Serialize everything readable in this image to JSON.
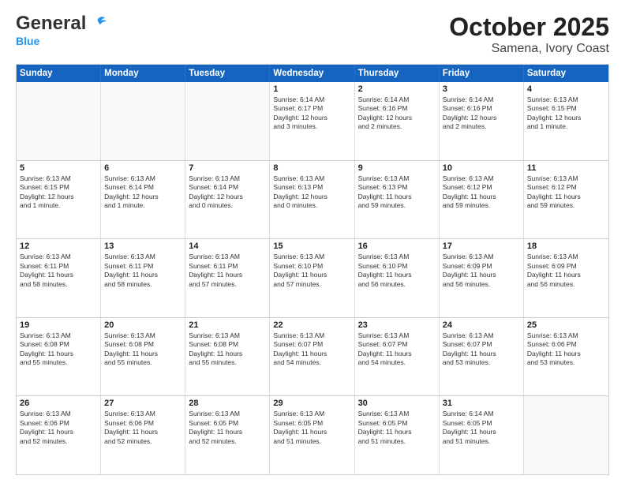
{
  "header": {
    "logo_general": "General",
    "logo_blue": "Blue",
    "main_title": "October 2025",
    "subtitle": "Samena, Ivory Coast"
  },
  "weekdays": [
    "Sunday",
    "Monday",
    "Tuesday",
    "Wednesday",
    "Thursday",
    "Friday",
    "Saturday"
  ],
  "weeks": [
    [
      {
        "day": "",
        "lines": []
      },
      {
        "day": "",
        "lines": []
      },
      {
        "day": "",
        "lines": []
      },
      {
        "day": "1",
        "lines": [
          "Sunrise: 6:14 AM",
          "Sunset: 6:17 PM",
          "Daylight: 12 hours",
          "and 3 minutes."
        ]
      },
      {
        "day": "2",
        "lines": [
          "Sunrise: 6:14 AM",
          "Sunset: 6:16 PM",
          "Daylight: 12 hours",
          "and 2 minutes."
        ]
      },
      {
        "day": "3",
        "lines": [
          "Sunrise: 6:14 AM",
          "Sunset: 6:16 PM",
          "Daylight: 12 hours",
          "and 2 minutes."
        ]
      },
      {
        "day": "4",
        "lines": [
          "Sunrise: 6:13 AM",
          "Sunset: 6:15 PM",
          "Daylight: 12 hours",
          "and 1 minute."
        ]
      }
    ],
    [
      {
        "day": "5",
        "lines": [
          "Sunrise: 6:13 AM",
          "Sunset: 6:15 PM",
          "Daylight: 12 hours",
          "and 1 minute."
        ]
      },
      {
        "day": "6",
        "lines": [
          "Sunrise: 6:13 AM",
          "Sunset: 6:14 PM",
          "Daylight: 12 hours",
          "and 1 minute."
        ]
      },
      {
        "day": "7",
        "lines": [
          "Sunrise: 6:13 AM",
          "Sunset: 6:14 PM",
          "Daylight: 12 hours",
          "and 0 minutes."
        ]
      },
      {
        "day": "8",
        "lines": [
          "Sunrise: 6:13 AM",
          "Sunset: 6:13 PM",
          "Daylight: 12 hours",
          "and 0 minutes."
        ]
      },
      {
        "day": "9",
        "lines": [
          "Sunrise: 6:13 AM",
          "Sunset: 6:13 PM",
          "Daylight: 11 hours",
          "and 59 minutes."
        ]
      },
      {
        "day": "10",
        "lines": [
          "Sunrise: 6:13 AM",
          "Sunset: 6:12 PM",
          "Daylight: 11 hours",
          "and 59 minutes."
        ]
      },
      {
        "day": "11",
        "lines": [
          "Sunrise: 6:13 AM",
          "Sunset: 6:12 PM",
          "Daylight: 11 hours",
          "and 59 minutes."
        ]
      }
    ],
    [
      {
        "day": "12",
        "lines": [
          "Sunrise: 6:13 AM",
          "Sunset: 6:11 PM",
          "Daylight: 11 hours",
          "and 58 minutes."
        ]
      },
      {
        "day": "13",
        "lines": [
          "Sunrise: 6:13 AM",
          "Sunset: 6:11 PM",
          "Daylight: 11 hours",
          "and 58 minutes."
        ]
      },
      {
        "day": "14",
        "lines": [
          "Sunrise: 6:13 AM",
          "Sunset: 6:11 PM",
          "Daylight: 11 hours",
          "and 57 minutes."
        ]
      },
      {
        "day": "15",
        "lines": [
          "Sunrise: 6:13 AM",
          "Sunset: 6:10 PM",
          "Daylight: 11 hours",
          "and 57 minutes."
        ]
      },
      {
        "day": "16",
        "lines": [
          "Sunrise: 6:13 AM",
          "Sunset: 6:10 PM",
          "Daylight: 11 hours",
          "and 56 minutes."
        ]
      },
      {
        "day": "17",
        "lines": [
          "Sunrise: 6:13 AM",
          "Sunset: 6:09 PM",
          "Daylight: 11 hours",
          "and 56 minutes."
        ]
      },
      {
        "day": "18",
        "lines": [
          "Sunrise: 6:13 AM",
          "Sunset: 6:09 PM",
          "Daylight: 11 hours",
          "and 56 minutes."
        ]
      }
    ],
    [
      {
        "day": "19",
        "lines": [
          "Sunrise: 6:13 AM",
          "Sunset: 6:08 PM",
          "Daylight: 11 hours",
          "and 55 minutes."
        ]
      },
      {
        "day": "20",
        "lines": [
          "Sunrise: 6:13 AM",
          "Sunset: 6:08 PM",
          "Daylight: 11 hours",
          "and 55 minutes."
        ]
      },
      {
        "day": "21",
        "lines": [
          "Sunrise: 6:13 AM",
          "Sunset: 6:08 PM",
          "Daylight: 11 hours",
          "and 55 minutes."
        ]
      },
      {
        "day": "22",
        "lines": [
          "Sunrise: 6:13 AM",
          "Sunset: 6:07 PM",
          "Daylight: 11 hours",
          "and 54 minutes."
        ]
      },
      {
        "day": "23",
        "lines": [
          "Sunrise: 6:13 AM",
          "Sunset: 6:07 PM",
          "Daylight: 11 hours",
          "and 54 minutes."
        ]
      },
      {
        "day": "24",
        "lines": [
          "Sunrise: 6:13 AM",
          "Sunset: 6:07 PM",
          "Daylight: 11 hours",
          "and 53 minutes."
        ]
      },
      {
        "day": "25",
        "lines": [
          "Sunrise: 6:13 AM",
          "Sunset: 6:06 PM",
          "Daylight: 11 hours",
          "and 53 minutes."
        ]
      }
    ],
    [
      {
        "day": "26",
        "lines": [
          "Sunrise: 6:13 AM",
          "Sunset: 6:06 PM",
          "Daylight: 11 hours",
          "and 52 minutes."
        ]
      },
      {
        "day": "27",
        "lines": [
          "Sunrise: 6:13 AM",
          "Sunset: 6:06 PM",
          "Daylight: 11 hours",
          "and 52 minutes."
        ]
      },
      {
        "day": "28",
        "lines": [
          "Sunrise: 6:13 AM",
          "Sunset: 6:05 PM",
          "Daylight: 11 hours",
          "and 52 minutes."
        ]
      },
      {
        "day": "29",
        "lines": [
          "Sunrise: 6:13 AM",
          "Sunset: 6:05 PM",
          "Daylight: 11 hours",
          "and 51 minutes."
        ]
      },
      {
        "day": "30",
        "lines": [
          "Sunrise: 6:13 AM",
          "Sunset: 6:05 PM",
          "Daylight: 11 hours",
          "and 51 minutes."
        ]
      },
      {
        "day": "31",
        "lines": [
          "Sunrise: 6:14 AM",
          "Sunset: 6:05 PM",
          "Daylight: 11 hours",
          "and 51 minutes."
        ]
      },
      {
        "day": "",
        "lines": []
      }
    ]
  ]
}
